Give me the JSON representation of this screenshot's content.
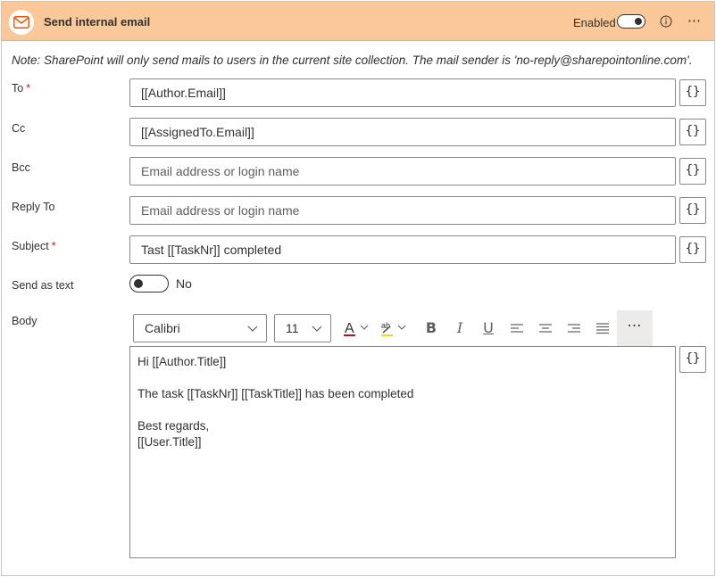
{
  "header": {
    "title": "Send internal email",
    "enabled_label": "Enabled",
    "enabled": true,
    "accent_color": "#fbc999"
  },
  "note": "Note: SharePoint will only send mails to users in the current site collection. The mail sender is 'no-reply@sharepointonline.com'.",
  "fields": {
    "to": {
      "label": "To",
      "required": "*",
      "value": "[[Author.Email]]"
    },
    "cc": {
      "label": "Cc",
      "value": "[[AssignedTo.Email]]"
    },
    "bcc": {
      "label": "Bcc",
      "placeholder": "Email address or login name"
    },
    "reply_to": {
      "label": "Reply To",
      "placeholder": "Email address or login name"
    },
    "subject": {
      "label": "Subject",
      "required": "*",
      "value": "Tast [[TaskNr]] completed"
    }
  },
  "send_as_text": {
    "label": "Send as text",
    "value": "No",
    "on": false
  },
  "body": {
    "label": "Body",
    "font": "Calibri",
    "size": "11",
    "lines": [
      "Hi [[Author.Title]]",
      "",
      "The task [[TaskNr]] [[TaskTitle]] has been completed",
      "",
      "Best regards,",
      "[[User.Title]]"
    ]
  },
  "dynamic_button_label": "{}",
  "icons": [
    "mail-icon",
    "info-icon",
    "more-icon",
    "chevron-down-icon",
    "font-color-icon",
    "highlight-icon",
    "bold-icon",
    "italic-icon",
    "underline-icon",
    "align-left-icon",
    "align-center-icon",
    "align-right-icon",
    "justify-icon"
  ]
}
